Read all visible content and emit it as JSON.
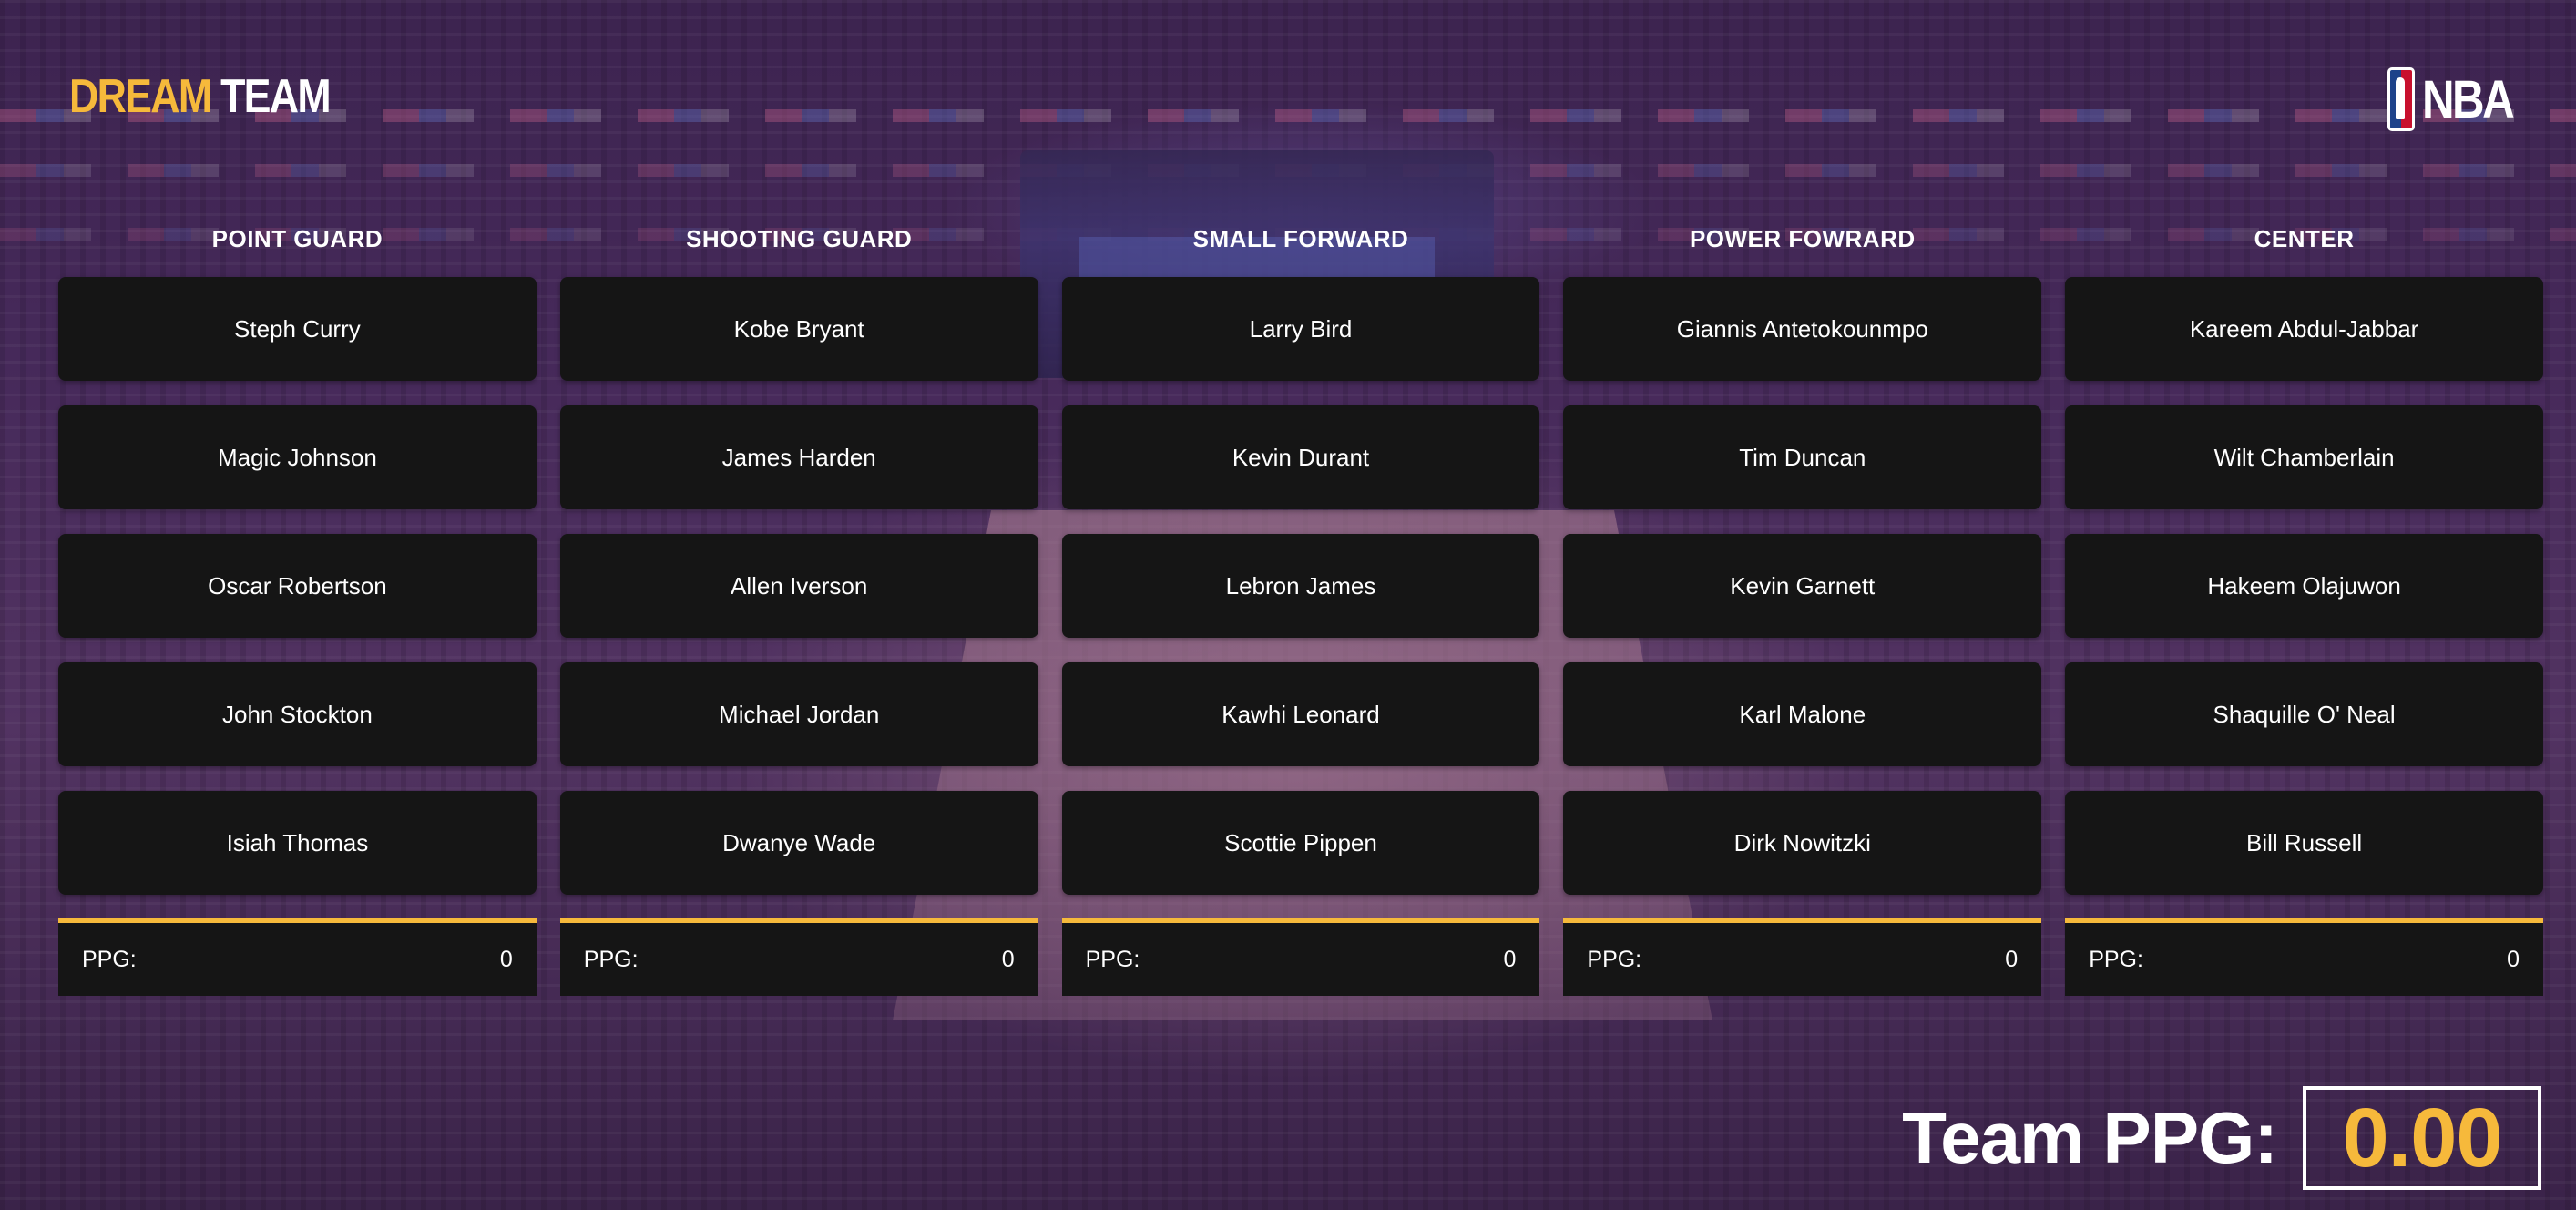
{
  "header": {
    "logo_part1": "DREAM",
    "logo_part2": " TEAM",
    "nba_label": "NBA"
  },
  "colors": {
    "accent": "#f6b93b",
    "card_background": "#151515",
    "text": "#ffffff"
  },
  "columns": [
    {
      "title": "POINT GUARD",
      "players": [
        "Steph Curry",
        "Magic Johnson",
        "Oscar Robertson",
        "John Stockton",
        "Isiah Thomas"
      ],
      "ppg_label": "PPG:",
      "ppg_value": "0"
    },
    {
      "title": "SHOOTING GUARD",
      "players": [
        "Kobe Bryant",
        "James Harden",
        "Allen Iverson",
        "Michael Jordan",
        "Dwanye Wade"
      ],
      "ppg_label": "PPG:",
      "ppg_value": "0"
    },
    {
      "title": "SMALL FORWARD",
      "players": [
        "Larry Bird",
        "Kevin Durant",
        "Lebron James",
        "Kawhi Leonard",
        "Scottie Pippen"
      ],
      "ppg_label": "PPG:",
      "ppg_value": "0"
    },
    {
      "title": "POWER FOWRARD",
      "players": [
        "Giannis Antetokounmpo",
        "Tim Duncan",
        "Kevin Garnett",
        "Karl Malone",
        "Dirk Nowitzki"
      ],
      "ppg_label": "PPG:",
      "ppg_value": "0"
    },
    {
      "title": "CENTER",
      "players": [
        "Kareem Abdul-Jabbar",
        "Wilt Chamberlain",
        "Hakeem Olajuwon",
        "Shaquille O' Neal",
        "Bill Russell"
      ],
      "ppg_label": "PPG:",
      "ppg_value": "0"
    }
  ],
  "team": {
    "label": "Team PPG:",
    "value": "0.00"
  }
}
